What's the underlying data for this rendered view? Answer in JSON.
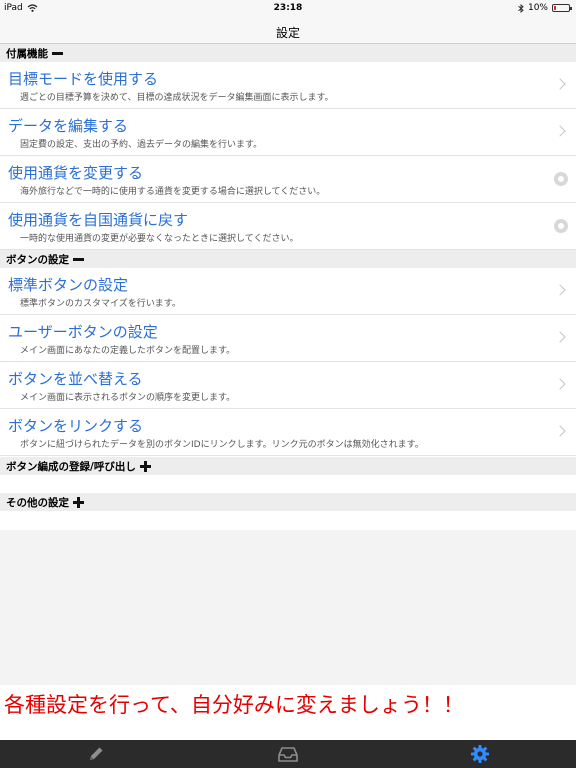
{
  "status_bar": {
    "device": "iPad",
    "time": "23:18",
    "battery": "10%",
    "battery_level": 0.1
  },
  "nav": {
    "title": "設定"
  },
  "sections": {
    "accessory": {
      "header": "付属機能",
      "items": [
        {
          "title": "目標モードを使用する",
          "subtitle": "週ごとの目標予算を決めて、目標の達成状況をデータ編集画面に表示します。"
        },
        {
          "title": "データを編集する",
          "subtitle": "固定費の設定、支出の予約、過去データの編集を行います。"
        },
        {
          "title": "使用通貨を変更する",
          "subtitle": "海外旅行などで一時的に使用する通貨を変更する場合に選択してください。"
        },
        {
          "title": "使用通貨を自国通貨に戻す",
          "subtitle": "一時的な使用通貨の変更が必要なくなったときに選択してください。"
        }
      ]
    },
    "buttons": {
      "header": "ボタンの設定",
      "items": [
        {
          "title": "標準ボタンの設定",
          "subtitle": "標準ボタンのカスタマイズを行います。"
        },
        {
          "title": "ユーザーボタンの設定",
          "subtitle": "メイン画面にあなたの定義したボタンを配置します。"
        },
        {
          "title": "ボタンを並べ替える",
          "subtitle": "メイン画面に表示されるボタンの順序を変更します。"
        },
        {
          "title": "ボタンをリンクする",
          "subtitle": "ボタンに紐づけられたデータを別のボタンIDにリンクします。リンク元のボタンは無効化されます。"
        }
      ]
    },
    "button_layout": {
      "header": "ボタン編成の登録/呼び出し"
    },
    "other": {
      "header": "その他の設定"
    }
  },
  "promo": {
    "text": "各種設定を行って、自分好みに変えましょう！！"
  },
  "tabs": [
    {
      "icon": "pencil-icon"
    },
    {
      "icon": "inbox-icon"
    },
    {
      "icon": "gear-icon",
      "active": true
    }
  ],
  "colors": {
    "link": "#2a6fd6",
    "promo": "#e60000",
    "tab_active": "#2f8cff",
    "tab_inactive": "#8e8e8e"
  }
}
